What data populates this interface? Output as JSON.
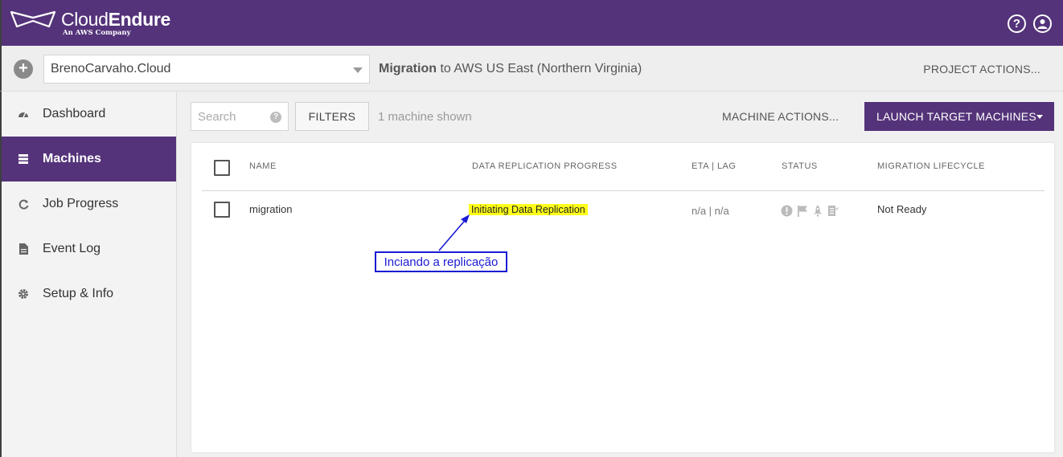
{
  "header": {
    "logo_name_light": "Cloud",
    "logo_name_bold": "Endure",
    "logo_sub": "An AWS Company",
    "help_icon": "question-circle-icon",
    "user_icon": "user-circle-icon"
  },
  "project_bar": {
    "project_name": "BrenoCarvaho.Cloud",
    "migration_bold": "Migration",
    "migration_rest": " to AWS US East (Northern Virginia)",
    "project_actions": "PROJECT ACTIONS..."
  },
  "sidebar": {
    "items": [
      {
        "label": "Dashboard",
        "icon": "dashboard-gauge-icon"
      },
      {
        "label": "Machines",
        "icon": "server-icon",
        "active": true
      },
      {
        "label": "Job Progress",
        "icon": "refresh-icon"
      },
      {
        "label": "Event Log",
        "icon": "document-icon"
      },
      {
        "label": "Setup & Info",
        "icon": "gear-icon"
      }
    ]
  },
  "toolbar": {
    "search_placeholder": "Search",
    "help_glyph": "?",
    "filters": "FILTERS",
    "machines_shown": "1 machine shown",
    "machine_actions": "MACHINE ACTIONS...",
    "launch": "LAUNCH TARGET MACHINES"
  },
  "table": {
    "columns": [
      "NAME",
      "DATA REPLICATION PROGRESS",
      "ETA | LAG",
      "STATUS",
      "MIGRATION LIFECYCLE"
    ],
    "rows": [
      {
        "name": "migration",
        "replication": "Initiating Data Replication",
        "eta_lag": "n/a | n/a",
        "status_icons": [
          "exclamation-icon",
          "flag-icon",
          "rocket-icon",
          "checklist-icon"
        ],
        "lifecycle": "Not Ready"
      }
    ]
  },
  "annotation": {
    "text": "Inciando a replicação"
  },
  "colors": {
    "brand_purple": "#54337a",
    "highlight": "#ffff1a",
    "annotation_blue": "#1a1ad4"
  }
}
